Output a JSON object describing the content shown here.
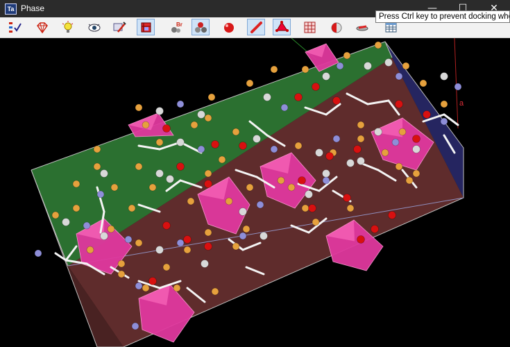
{
  "window": {
    "title": "Phase",
    "icon_text": "Ta",
    "minimize_glyph": "—",
    "maximize_glyph": "☐",
    "close_glyph": "✕"
  },
  "tooltip": {
    "text": "Press Ctrl key to prevent docking whe"
  },
  "toolbar": {
    "buttons": [
      {
        "name": "list-check-icon",
        "active": false
      },
      {
        "name": "crystal-gem-icon",
        "active": false
      },
      {
        "name": "lightbulb-icon",
        "active": false
      },
      {
        "name": "eye-icon",
        "active": false
      },
      {
        "name": "label-pen-icon",
        "active": false
      },
      {
        "name": "unit-cell-box-icon",
        "active": true
      },
      {
        "name": "bromine-atoms-icon",
        "active": false
      },
      {
        "name": "atoms-icon",
        "active": true
      },
      {
        "name": "oxygen-sphere-icon",
        "active": false
      },
      {
        "name": "bond-stick-icon",
        "active": true
      },
      {
        "name": "polyhedron-icon",
        "active": true
      },
      {
        "name": "grid-cube-icon",
        "active": false
      },
      {
        "name": "half-sphere-icon",
        "active": false
      },
      {
        "name": "plane-icon",
        "active": false
      },
      {
        "name": "table-icon",
        "active": false
      }
    ]
  },
  "viewport": {
    "axis_a_label": "a"
  },
  "colors": {
    "background": "#000000",
    "cell_face_green": "#2f7a34",
    "cell_face_red": "#7a3838",
    "cell_face_blue": "#29296a",
    "polyhedra": "#e0389e",
    "oxygen": "#d81010",
    "carbon": "#d8d8d8",
    "nitrogen": "#8e8ed8",
    "fluorine": "#e6a13d"
  }
}
